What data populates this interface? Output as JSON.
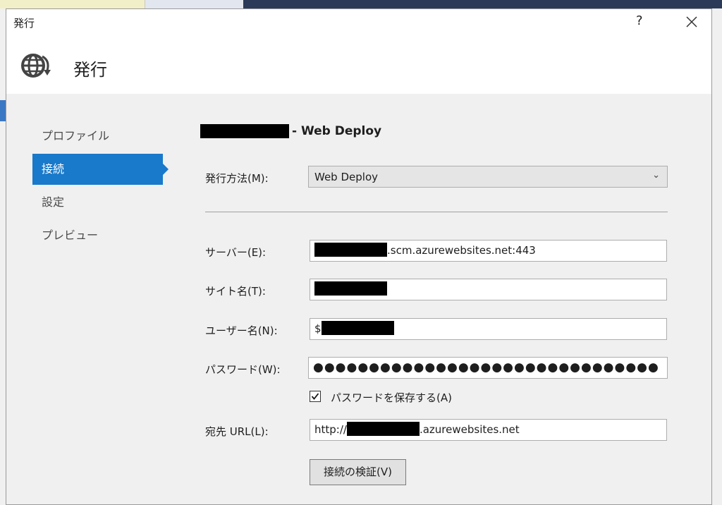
{
  "window": {
    "title": "発行",
    "help_label": "?"
  },
  "header": {
    "title": "発行",
    "icon": "globe-publish-icon"
  },
  "nav": {
    "items": [
      {
        "label": "プロファイル",
        "active": false
      },
      {
        "label": "接続",
        "active": true
      },
      {
        "label": "設定",
        "active": false
      },
      {
        "label": "プレビュー",
        "active": false
      }
    ]
  },
  "main": {
    "profile_title_suffix": "- Web Deploy",
    "method_label": "発行方法(M):",
    "method_value": "Web Deploy",
    "server_label": "サーバー(E):",
    "server_value_suffix": ".scm.azurewebsites.net:443",
    "site_label": "サイト名(T):",
    "user_label": "ユーザー名(N):",
    "user_prefix": "$",
    "password_label": "パスワード(W):",
    "password_mask": "●●●●●●●●●●●●●●●●●●●●●●●●●●●●●●●",
    "save_password_label": "パスワードを保存する(A)",
    "save_password_checked": true,
    "url_label": "宛先 URL(L):",
    "url_prefix": "http://",
    "url_suffix": ".azurewebsites.net",
    "validate_button": "接続の検証(V)"
  },
  "colors": {
    "accent": "#1979ca",
    "redaction": "#000000"
  }
}
